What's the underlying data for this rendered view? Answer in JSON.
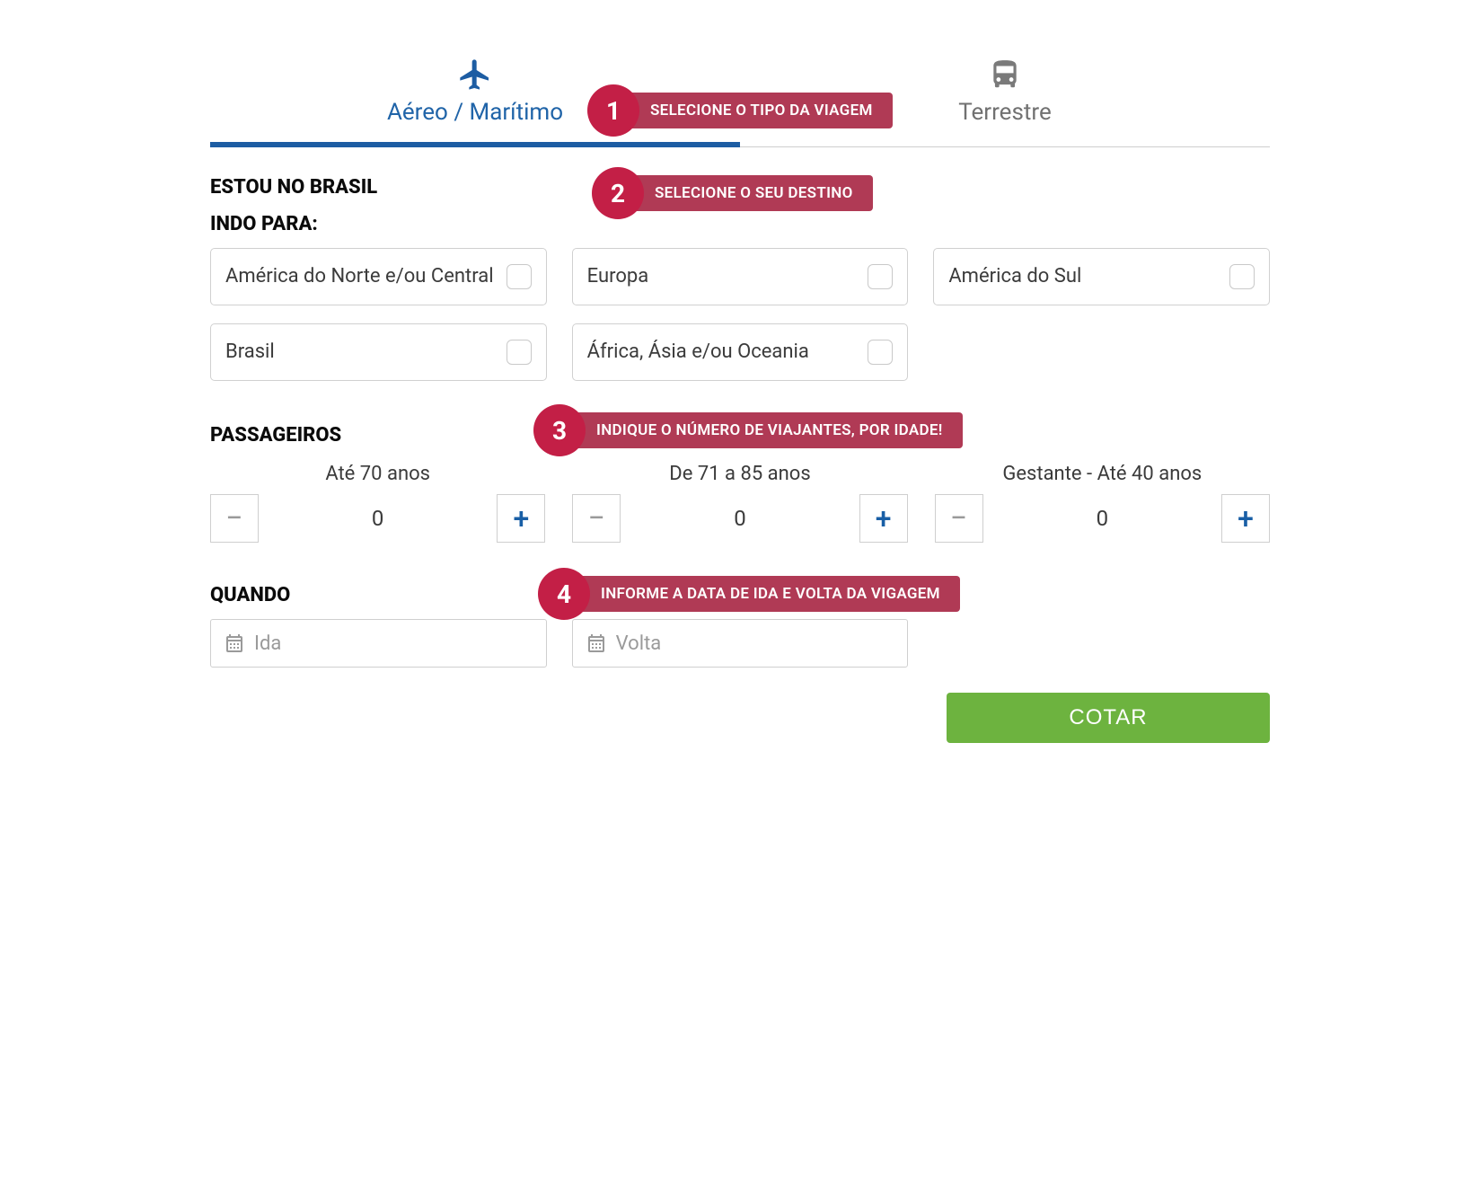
{
  "tabs": {
    "aereo_label": "Aéreo / Marítimo",
    "terrestre_label": "Terrestre"
  },
  "steps": {
    "s1": {
      "num": "1",
      "text": "SELECIONE O TIPO DA VIAGEM"
    },
    "s2": {
      "num": "2",
      "text": "SELECIONE O SEU DESTINO"
    },
    "s3": {
      "num": "3",
      "text": "INDIQUE O NÚMERO DE VIAJANTES, POR IDADE!"
    },
    "s4": {
      "num": "4",
      "text": "INFORME A DATA DE IDA E VOLTA DA VIGAGEM"
    }
  },
  "origin_heading": "ESTOU NO BRASIL",
  "going_to_heading": "INDO PARA:",
  "destinations": [
    {
      "label": "América do Norte e/ou Central"
    },
    {
      "label": "Europa"
    },
    {
      "label": "América do Sul"
    },
    {
      "label": "Brasil"
    },
    {
      "label": "África, Ásia e/ou Oceania"
    }
  ],
  "passengers_heading": "PASSAGEIROS",
  "passengers": [
    {
      "label": "Até 70 anos",
      "value": "0"
    },
    {
      "label": "De 71 a 85 anos",
      "value": "0"
    },
    {
      "label": "Gestante - Até 40 anos",
      "value": "0"
    }
  ],
  "when_heading": "QUANDO",
  "dates": {
    "ida_placeholder": "Ida",
    "volta_placeholder": "Volta"
  },
  "submit_label": "COTAR",
  "colors": {
    "primary_blue": "#1d5da3",
    "accent_red": "#c31f46",
    "accent_red_light": "#b03a55",
    "submit_green": "#6db33f"
  }
}
